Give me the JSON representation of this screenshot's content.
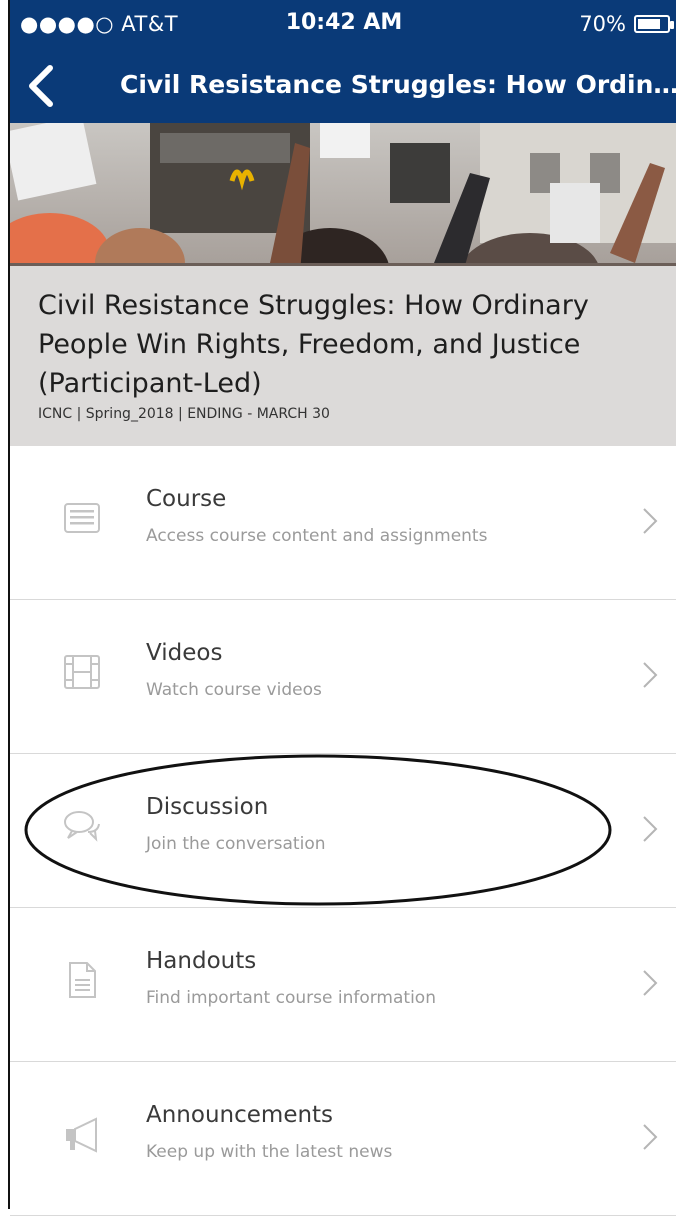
{
  "status_bar": {
    "carrier": "●●●●○ AT&T",
    "time": "10:42 AM",
    "battery": "70%"
  },
  "nav": {
    "title": "Civil Resistance Struggles: How Ordin…"
  },
  "hero": {
    "title": "Civil Resistance Struggles: How Ordinary People Win Rights, Freedom, and Justice (Participant-Led)",
    "subtitle": "ICNC | Spring_2018 | ENDING - MARCH 30"
  },
  "menu": [
    {
      "label": "Course",
      "description": "Access course content and assignments",
      "icon": "list-icon"
    },
    {
      "label": "Videos",
      "description": "Watch course videos",
      "icon": "film-icon"
    },
    {
      "label": "Discussion",
      "description": "Join the conversation",
      "icon": "chat-bubbles-icon"
    },
    {
      "label": "Handouts",
      "description": "Find important course information",
      "icon": "document-icon"
    },
    {
      "label": "Announcements",
      "description": "Keep up with the latest news",
      "icon": "megaphone-icon"
    }
  ],
  "colors": {
    "header": "#0a3a78",
    "icon": "#c4c4c4",
    "chevron": "#b5b5b5"
  }
}
